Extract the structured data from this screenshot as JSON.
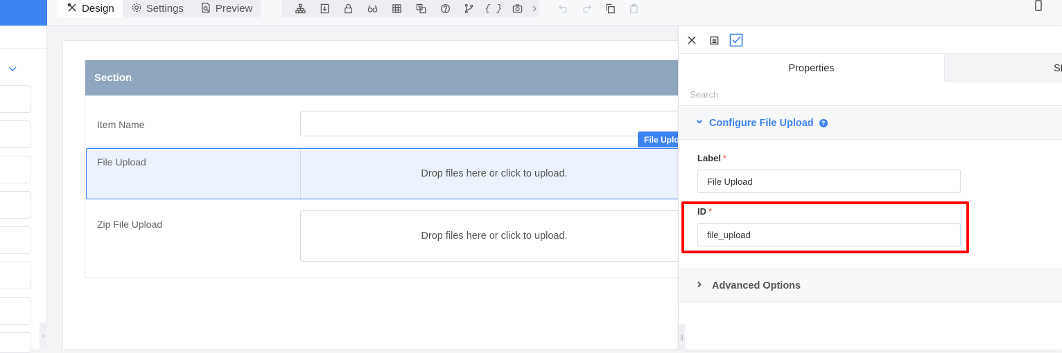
{
  "toolbar": {
    "tabs": [
      {
        "label": "Design",
        "icon": "design-tools-icon",
        "active": true
      },
      {
        "label": "Settings",
        "icon": "gear-icon",
        "active": false
      },
      {
        "label": "Preview",
        "icon": "preview-doc-icon",
        "active": false
      }
    ],
    "tool_icons": [
      "hierarchy-icon",
      "pdf-icon",
      "lock-icon",
      "glasses-icon",
      "table-icon",
      "translate-icon",
      "help-icon",
      "branch-icon",
      "braces-icon",
      "camera-icon",
      "chevron-right-icon"
    ],
    "braces_glyph": "{ }",
    "edit_icons": [
      "undo-icon",
      "redo-icon",
      "copy-icon",
      "paste-icon"
    ],
    "device_icon": "mobile-device-icon"
  },
  "form": {
    "section_title": "Section",
    "fields": [
      {
        "label": "Item Name",
        "type": "text"
      },
      {
        "label": "File Upload",
        "type": "upload",
        "placeholder": "Drop files here or click to upload.",
        "selected": true
      },
      {
        "label": "Zip File Upload",
        "type": "upload",
        "placeholder": "Drop files here or click to upload."
      }
    ],
    "selected_tag": "File Upload"
  },
  "panel": {
    "tabs": [
      {
        "label": "Properties",
        "active": true
      },
      {
        "label": "Style",
        "active": false
      }
    ],
    "search_placeholder": "Search",
    "configure_title": "Configure File Upload",
    "help_glyph": "?",
    "label_field": {
      "label": "Label",
      "required_mark": "*",
      "value": "File Upload"
    },
    "id_field": {
      "label": "ID",
      "required_mark": "*",
      "value": "file_upload"
    },
    "advanced_title": "Advanced Options"
  },
  "colors": {
    "accent": "#3d83f1",
    "section_header": "#8fa6bc",
    "highlight": "#ff0000",
    "required": "#e34b4b"
  }
}
